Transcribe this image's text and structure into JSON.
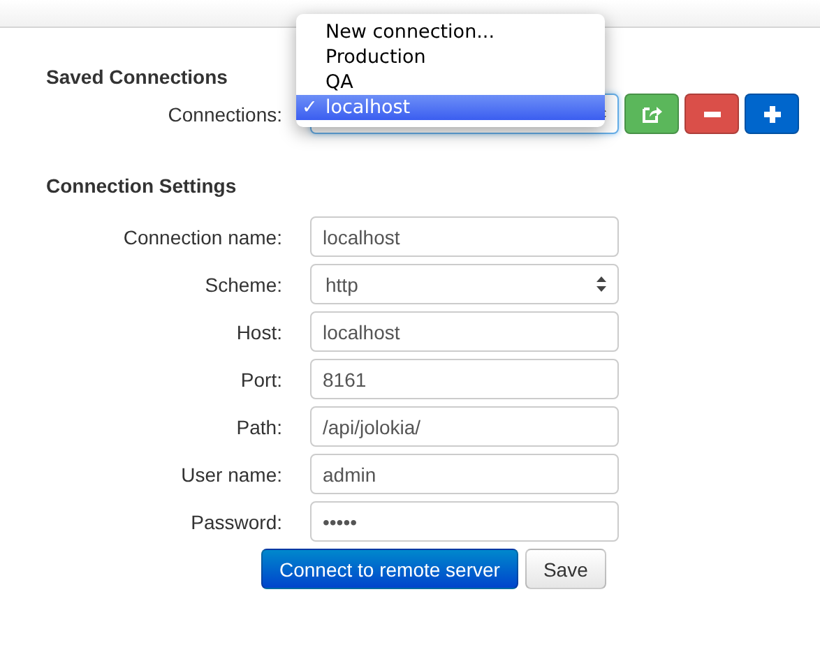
{
  "saved_connections": {
    "heading": "Saved Connections",
    "label": "Connections:",
    "menu": [
      {
        "label": "New connection...",
        "selected": false
      },
      {
        "label": "Production",
        "selected": false
      },
      {
        "label": "QA",
        "selected": false
      },
      {
        "label": "localhost",
        "selected": true
      }
    ],
    "check_mark": "✓",
    "buttons": [
      {
        "kind": "share",
        "color": "#5bb75b"
      },
      {
        "kind": "minus",
        "color": "#da4f49"
      },
      {
        "kind": "plus",
        "color": "#0066cc"
      }
    ]
  },
  "connection_settings": {
    "heading": "Connection Settings",
    "fields": [
      {
        "label": "Connection name:",
        "kind": "text",
        "value": "localhost"
      },
      {
        "label": "Scheme:",
        "kind": "select",
        "value": "http"
      },
      {
        "label": "Host:",
        "kind": "text",
        "value": "localhost"
      },
      {
        "label": "Port:",
        "kind": "text",
        "value": "8161"
      },
      {
        "label": "Path:",
        "kind": "text",
        "value": "/api/jolokia/"
      },
      {
        "label": "User name:",
        "kind": "text",
        "value": "admin"
      },
      {
        "label": "Password:",
        "kind": "password",
        "value": "•••••"
      }
    ],
    "buttons": [
      {
        "label": "Connect to remote server",
        "kind": "primary"
      },
      {
        "label": "Save",
        "kind": "default"
      }
    ]
  }
}
